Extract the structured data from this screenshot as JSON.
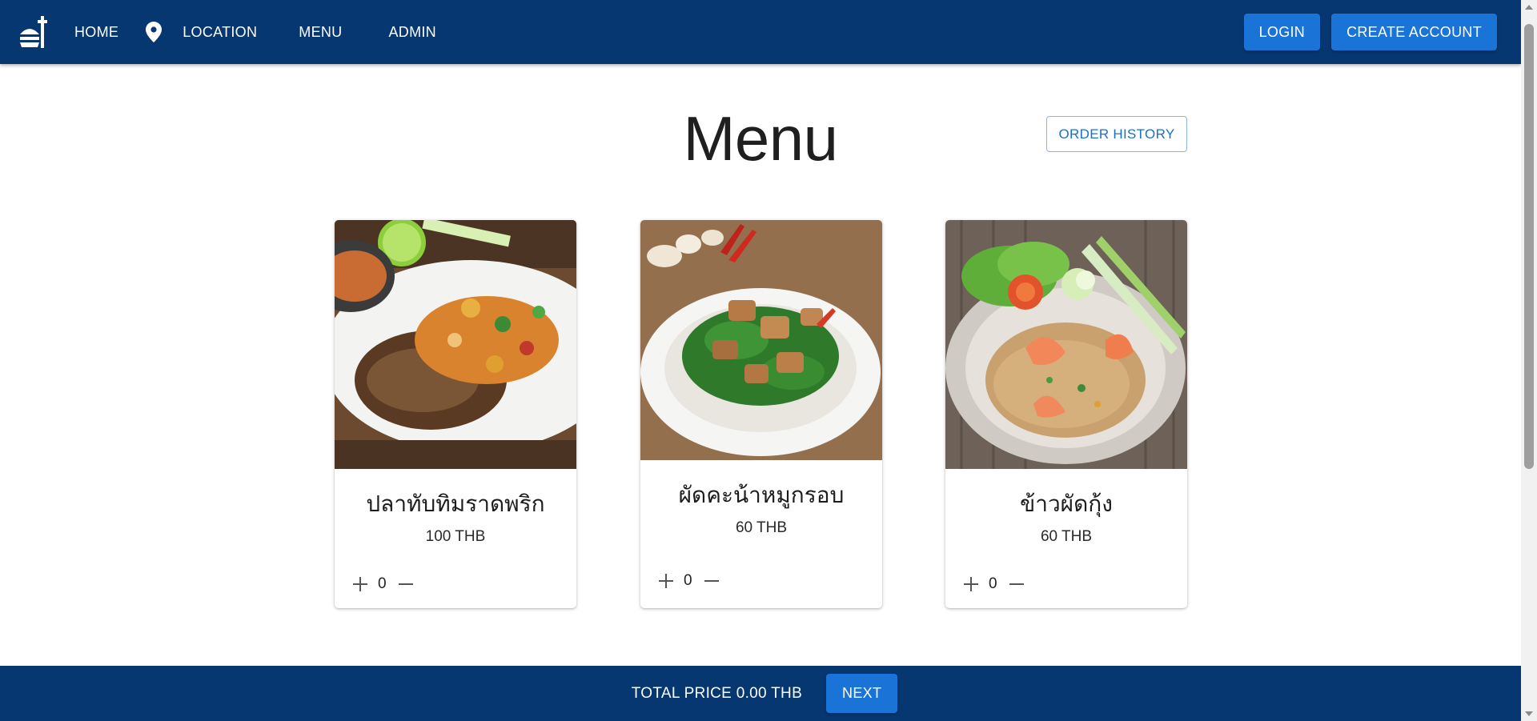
{
  "nav": {
    "logo_icon": "food-serving-icon",
    "items": [
      {
        "label": "HOME"
      },
      {
        "label": "LOCATION",
        "icon": "location-pin-icon"
      },
      {
        "label": "MENU"
      },
      {
        "label": "ADMIN"
      }
    ],
    "login_label": "LOGIN",
    "create_account_label": "CREATE ACCOUNT"
  },
  "main": {
    "title": "Menu",
    "order_history_label": "ORDER HISTORY",
    "items": [
      {
        "name": "ปลาทับทิมราดพริก",
        "price": "100 THB",
        "qty": "0",
        "image": "fried-fish-dish"
      },
      {
        "name": "ผัดคะน้าหมูกรอบ",
        "price": "60 THB",
        "qty": "0",
        "image": "kale-crispy-pork-dish"
      },
      {
        "name": "ข้าวผัดกุ้ง",
        "price": "60 THB",
        "qty": "0",
        "image": "shrimp-fried-rice-dish"
      }
    ]
  },
  "footer": {
    "total_label": "TOTAL PRICE 0.00 THB",
    "next_label": "NEXT"
  },
  "colors": {
    "appbar": "#073770",
    "primary": "#1a73d6",
    "outline_text": "#1a6fc9"
  }
}
